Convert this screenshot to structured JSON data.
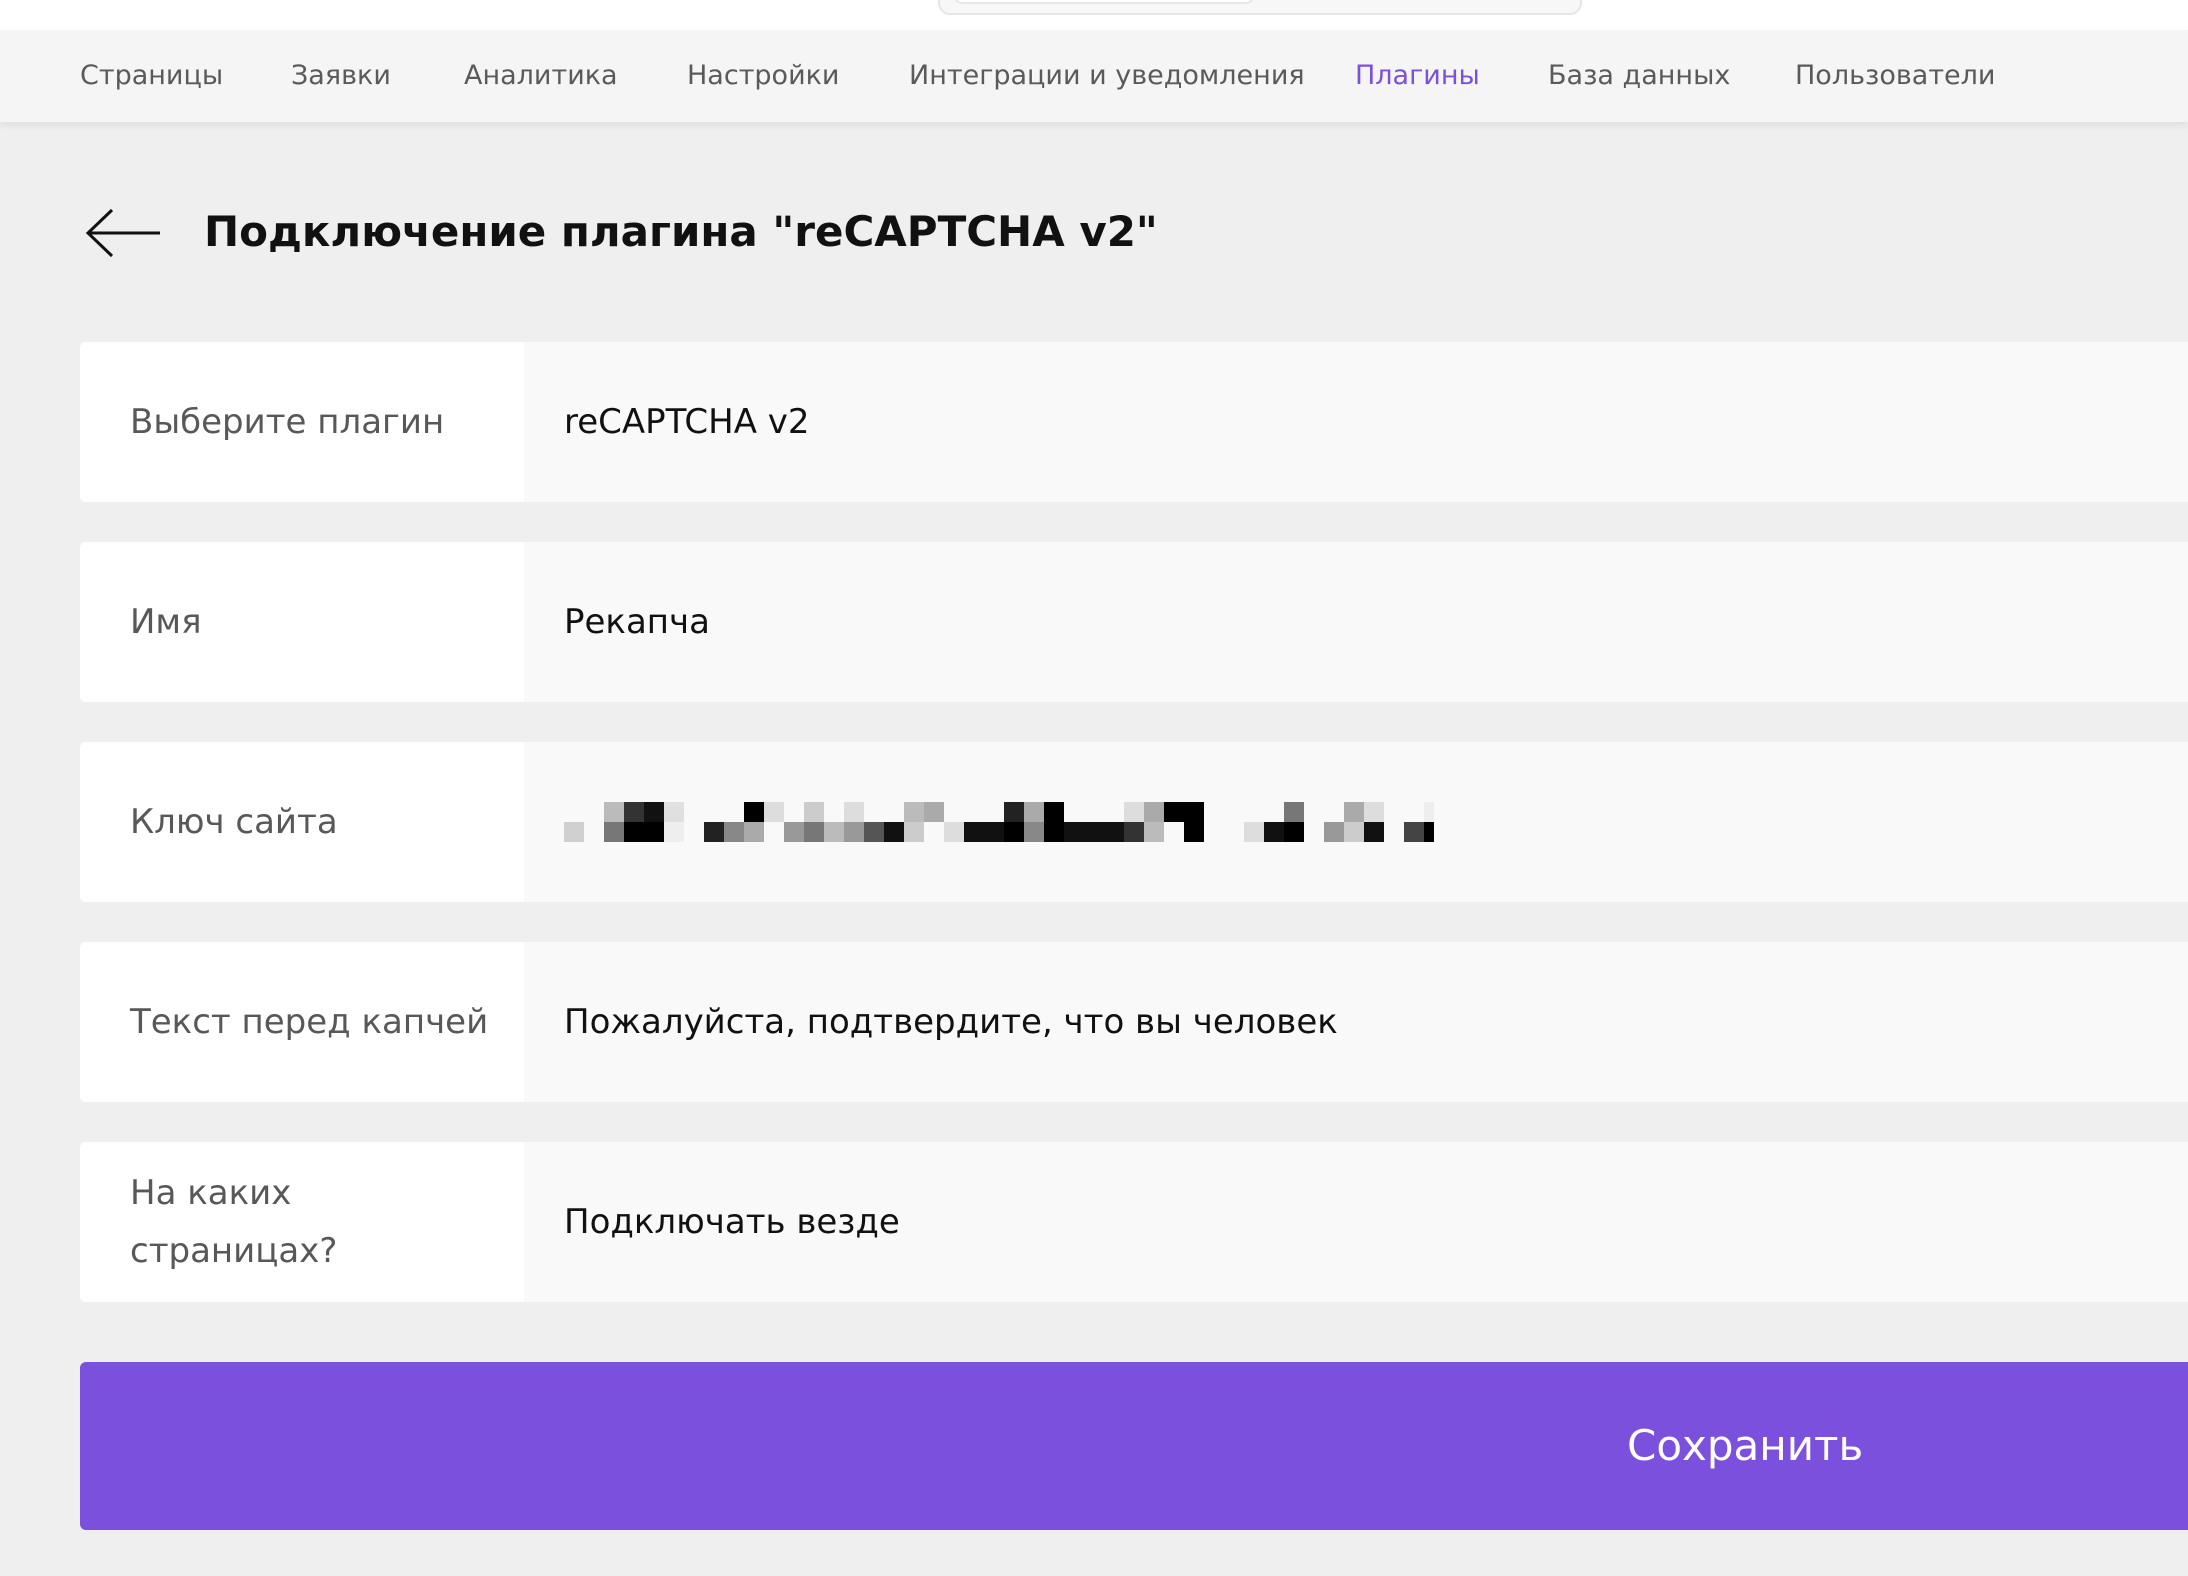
{
  "nav": {
    "items": [
      {
        "label": "Страницы"
      },
      {
        "label": "Заявки"
      },
      {
        "label": "Аналитика"
      },
      {
        "label": "Настройки"
      },
      {
        "label": "Интеграции и уведомления"
      },
      {
        "label": "Плагины"
      },
      {
        "label": "База данных"
      },
      {
        "label": "Пользователи"
      }
    ],
    "active": "Плагины",
    "accent_color": "#7b50dc"
  },
  "header": {
    "title": "Подключение плагина \"reCAPTCHA v2\"",
    "back_icon": "arrow-left-icon"
  },
  "form": {
    "plugin": {
      "label": "Выберите плагин",
      "value": "reCAPTCHA v2"
    },
    "name": {
      "label": "Имя",
      "value": "Рекапча"
    },
    "site_key": {
      "label": "Ключ сайта",
      "value_state": "pixelated / redacted"
    },
    "text_before": {
      "label": "Текст перед капчей",
      "value": "Пожалуйста, подтвердите, что вы человек"
    },
    "pages": {
      "label": "На каких страницах?",
      "value": "Подключать везде"
    }
  },
  "actions": {
    "save_label": "Сохранить",
    "save_color": "#7b50dc"
  }
}
